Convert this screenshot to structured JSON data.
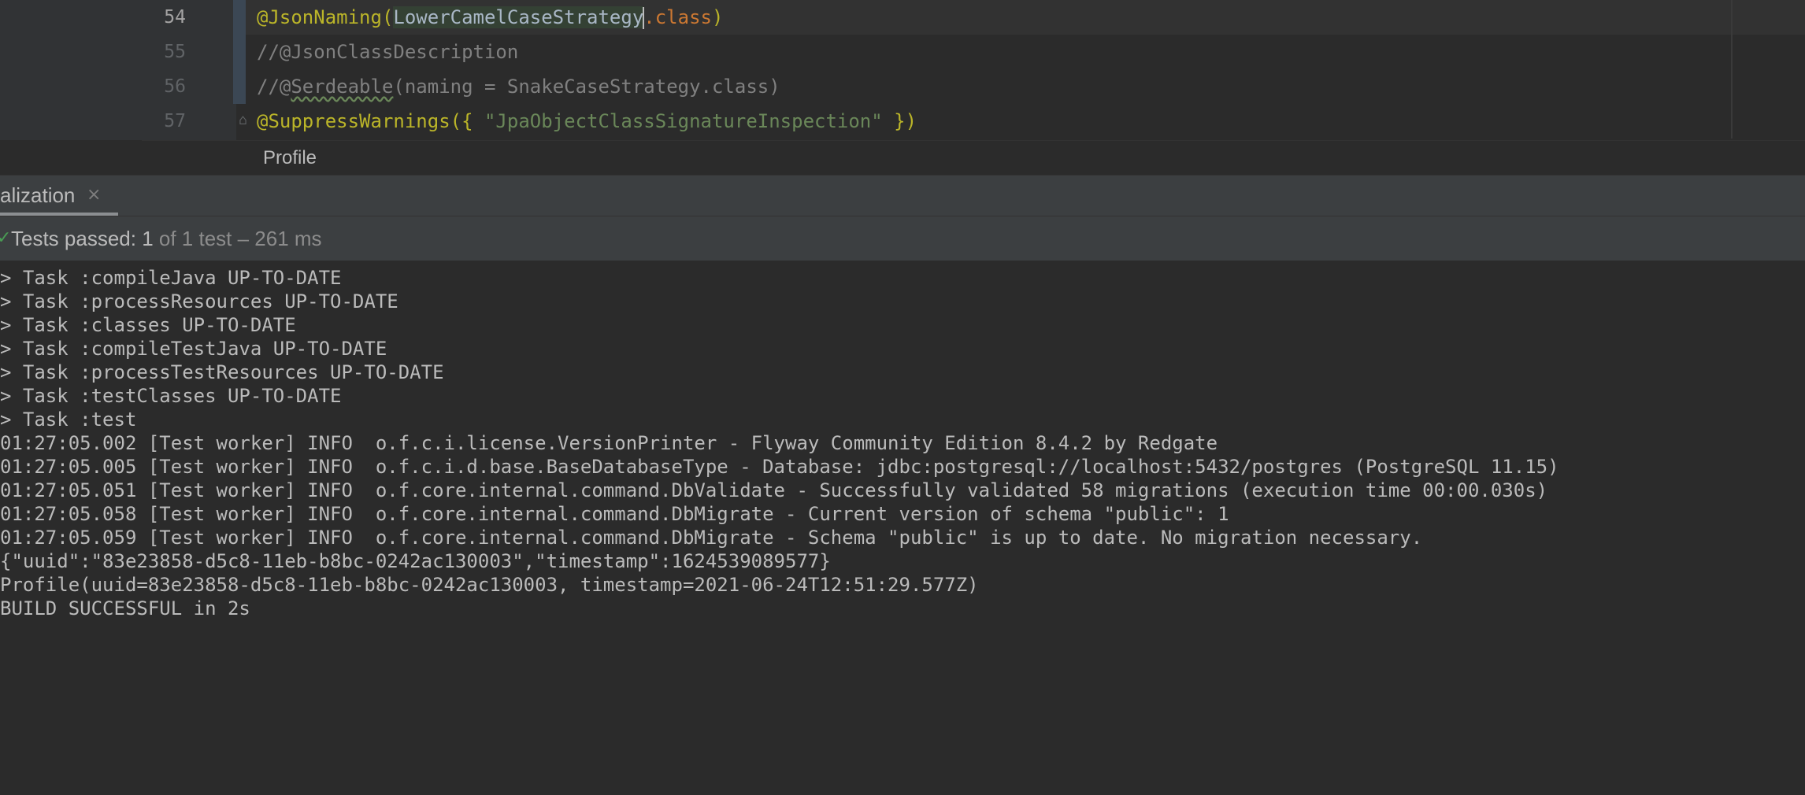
{
  "editor": {
    "lines": [
      {
        "number": "54",
        "tokens": [
          "@JsonNaming(",
          "LowerCamelCaseStrategy",
          ".class",
          ")"
        ]
      },
      {
        "number": "55",
        "text": "//@JsonClassDescription"
      },
      {
        "number": "56",
        "tokens": [
          "//@",
          "Serdeable",
          "(naming = SnakeCaseStrategy.class)"
        ]
      },
      {
        "number": "57",
        "tokens": [
          "@SuppressWarnings({ ",
          "\"JpaObjectClassSignatureInspection\"",
          " })"
        ]
      }
    ],
    "breadcrumb": "Profile"
  },
  "run_window": {
    "tab_label": "alization",
    "close_glyph": "×",
    "status": {
      "check_glyph": "✓",
      "passed_label": "Tests passed: 1",
      "detail": " of 1 test – 261 ms"
    },
    "console_lines": [
      "> Task :compileJava UP-TO-DATE",
      "> Task :processResources UP-TO-DATE",
      "> Task :classes UP-TO-DATE",
      "> Task :compileTestJava UP-TO-DATE",
      "> Task :processTestResources UP-TO-DATE",
      "> Task :testClasses UP-TO-DATE",
      "> Task :test",
      "01:27:05.002 [Test worker] INFO  o.f.c.i.license.VersionPrinter - Flyway Community Edition 8.4.2 by Redgate",
      "01:27:05.005 [Test worker] INFO  o.f.c.i.d.base.BaseDatabaseType - Database: jdbc:postgresql://localhost:5432/postgres (PostgreSQL 11.15)",
      "01:27:05.051 [Test worker] INFO  o.f.core.internal.command.DbValidate - Successfully validated 58 migrations (execution time 00:00.030s)",
      "01:27:05.058 [Test worker] INFO  o.f.core.internal.command.DbMigrate - Current version of schema \"public\": 1",
      "01:27:05.059 [Test worker] INFO  o.f.core.internal.command.DbMigrate - Schema \"public\" is up to date. No migration necessary.",
      "{\"uuid\":\"83e23858-d5c8-11eb-b8bc-0242ac130003\",\"timestamp\":1624539089577}",
      "Profile(uuid=83e23858-d5c8-11eb-b8bc-0242ac130003, timestamp=2021-06-24T12:51:29.577Z)",
      "BUILD SUCCESSFUL in 2s"
    ]
  },
  "colors": {
    "background": "#2b2b2b",
    "annotation": "#bbb529",
    "keyword": "#cc7832",
    "string": "#6a8759",
    "comment": "#808080",
    "success": "#499c54"
  }
}
